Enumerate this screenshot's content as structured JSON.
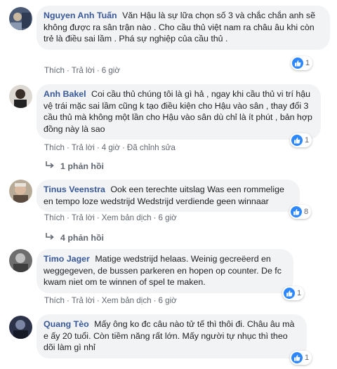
{
  "comments": [
    {
      "author": "Nguyen Anh Tuấn",
      "text": "Văn Hậu là sự lữa chọn số 3 và chắc chắn anh sẽ không được ra sân trận nào . Cho cầu thủ việt nam ra châu âu khi còn trẻ là điều sai lầm . Phá sự nghiệp của cầu thủ .",
      "like": "Thích",
      "reply": "Trả lời",
      "time": "6 giờ",
      "reaction_count": "1"
    },
    {
      "author": "Anh Bakel",
      "text": "Coi cầu thủ chúng tôi là gì hả , ngay khi cầu thủ vi trí hậu vệ trái mặc sai lầm cũng k tạo điều kiện cho Hậu vào sân , thay đổi 3 cầu thủ mà không một lần cho Hậu vào sân dù chỉ là ít phút , bản hợp đồng này là sao",
      "like": "Thích",
      "reply": "Trả lời",
      "time": "4 giờ",
      "edited": "Đã chỉnh sửa",
      "reaction_count": "1",
      "replies": "1 phản hồi"
    },
    {
      "author": "Tinus Veenstra",
      "text": "Ook een terechte uitslag Was een rommelige en tempo loze wedstrijd Wedstrijd verdiende geen winnaar",
      "like": "Thích",
      "reply": "Trả lời",
      "translate": "Xem bản dịch",
      "time": "6 giờ",
      "reaction_count": "8",
      "replies": "4 phản hồi"
    },
    {
      "author": "Timo Jager",
      "text": "Matige wedstrijd helaas. Weinig gecreëerd en weggegeven, de bussen parkeren en hopen op counter. De fc kwam niet om te winnen of spel te maken.",
      "like": "Thích",
      "reply": "Trả lời",
      "translate": "Xem bản dịch",
      "time": "6 giờ",
      "reaction_count": "1"
    },
    {
      "author": "Quang Tèo",
      "text": "Mấy ông ko đc câu nào tử tế thì thôi đi. Châu âu mà e ấy 20 tuổi. Còn tiềm năng rất lớn. Mấy người tự nhục thì theo dõi làm gì nhỉ",
      "reaction_count": "1"
    }
  ],
  "colors": {
    "name": "#385898",
    "bubble": "#f2f3f5",
    "meta": "#606770",
    "like": "#2d88ff"
  }
}
